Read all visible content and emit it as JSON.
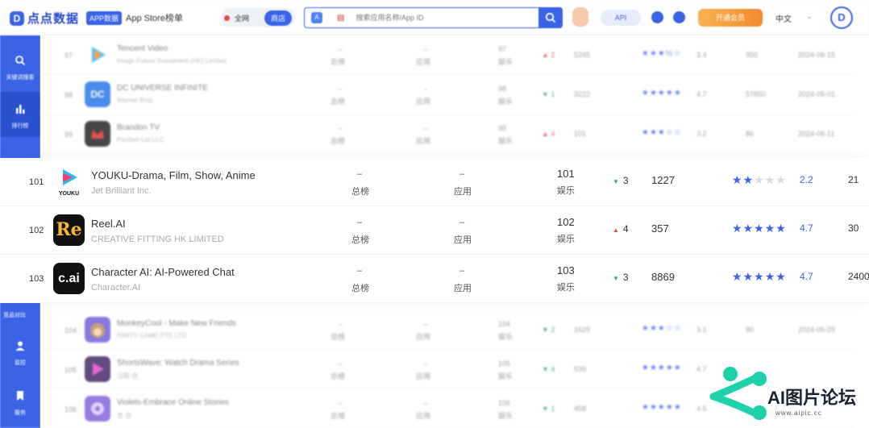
{
  "header": {
    "logo_text": "点点数据",
    "app_badge": "APP数据",
    "store_title": "App Store榜单",
    "scope_all": "全网",
    "scope_active": "商店",
    "search_placeholder": "搜索应用名称/App ID",
    "api_label": "API",
    "vip_label": "开通会员",
    "language": "中文",
    "avatar_letter": "D"
  },
  "sidebar": {
    "items": [
      {
        "label": "关键词搜索",
        "icon": "search-icon"
      },
      {
        "label": "排行榜",
        "icon": "bar-chart-icon"
      },
      {
        "label": "竞品对比",
        "icon": "compare-icon"
      },
      {
        "label": "监控",
        "icon": "user-icon"
      },
      {
        "label": "服务",
        "icon": "bookmark-icon"
      }
    ]
  },
  "blurred_rows_top": [
    {
      "rank": "97",
      "name": "Tencent Video",
      "publisher": "Image Future Investment (HK) Limited",
      "col_a": "–",
      "col_a_lbl": "总榜",
      "col_b": "–",
      "col_b_lbl": "应用",
      "col_c": "97",
      "col_c_lbl": "娱乐",
      "change": "▲ 2",
      "downloads": "5245",
      "stars": "★★★½☆",
      "score": "3.4",
      "reviews": "950",
      "date": "2024-06-15",
      "icon": "tencent-video-icon"
    },
    {
      "rank": "98",
      "name": "DC UNIVERSE INFINITE",
      "publisher": "Warner Bros",
      "col_a": "–",
      "col_a_lbl": "总榜",
      "col_b": "–",
      "col_b_lbl": "应用",
      "col_c": "98",
      "col_c_lbl": "娱乐",
      "change": "▼ 1",
      "downloads": "3222",
      "stars": "★★★★★",
      "score": "4.7",
      "reviews": "57850",
      "date": "2024-05-01",
      "icon": "dc-universe-icon"
    },
    {
      "rank": "99",
      "name": "Brandon TV",
      "publisher": "Panther Ltd LLC",
      "col_a": "–",
      "col_a_lbl": "总榜",
      "col_b": "–",
      "col_b_lbl": "应用",
      "col_c": "99",
      "col_c_lbl": "娱乐",
      "change": "▲ 4",
      "downloads": "101",
      "stars": "★★★☆☆",
      "score": "3.2",
      "reviews": "86",
      "date": "2024-06-11",
      "icon": "brandon-tv-icon"
    }
  ],
  "focused_rows": [
    {
      "rank": "101",
      "name": "YOUKU-Drama, Film, Show, Anime",
      "publisher": "Jet Brilliant Inc.",
      "col_a": "–",
      "col_a_lbl": "总榜",
      "col_b": "–",
      "col_b_lbl": "应用",
      "col_c": "101",
      "col_c_lbl": "娱乐",
      "change_dir": "down",
      "change": "3",
      "downloads": "1227",
      "stars_on": 2,
      "stars_total": 5,
      "score": "2.2",
      "reviews": "21",
      "icon_text": "YOUKU",
      "icon": "youku-icon"
    },
    {
      "rank": "102",
      "name": "Reel.AI",
      "publisher": "CREATIVE FITTING HK LIMITED",
      "col_a": "–",
      "col_a_lbl": "总榜",
      "col_b": "–",
      "col_b_lbl": "应用",
      "col_c": "102",
      "col_c_lbl": "娱乐",
      "change_dir": "up",
      "change": "4",
      "downloads": "357",
      "stars_on": 5,
      "stars_total": 5,
      "score": "4.7",
      "reviews": "30",
      "icon_text": "Re",
      "icon": "reel-ai-icon"
    },
    {
      "rank": "103",
      "name": "Character AI: AI-Powered Chat",
      "publisher": "Character.AI",
      "col_a": "–",
      "col_a_lbl": "总榜",
      "col_b": "–",
      "col_b_lbl": "应用",
      "col_c": "103",
      "col_c_lbl": "娱乐",
      "change_dir": "down",
      "change": "3",
      "downloads": "8869",
      "stars_on": 5,
      "stars_total": 5,
      "score": "4.7",
      "reviews": "2400",
      "icon_text": "c.ai",
      "icon": "character-ai-icon"
    }
  ],
  "blurred_rows_bottom": [
    {
      "rank": "104",
      "name": "MonkeyCool - Make New Friends",
      "publisher": "PARTY GAME PTE LTD",
      "col_a": "–",
      "col_a_lbl": "总榜",
      "col_b": "–",
      "col_b_lbl": "应用",
      "col_c": "104",
      "col_c_lbl": "娱乐",
      "change": "▼ 2",
      "downloads": "1629",
      "stars": "★★★☆☆",
      "score": "3.1",
      "reviews": "80",
      "date": "2024-05-29",
      "icon": "monkeycool-icon"
    },
    {
      "rank": "105",
      "name": "ShortsWave: Watch Drama Series",
      "publisher": "汉剧 合",
      "col_a": "–",
      "col_a_lbl": "总榜",
      "col_b": "–",
      "col_b_lbl": "应用",
      "col_c": "105",
      "col_c_lbl": "娱乐",
      "change": "▼ 4",
      "downloads": "539",
      "stars": "★★★★★",
      "score": "4.7",
      "reviews": "",
      "date": "",
      "icon": "shortswave-icon"
    },
    {
      "rank": "106",
      "name": "Violets-Embrace Online Stories",
      "publisher": "合 合",
      "col_a": "–",
      "col_a_lbl": "总榜",
      "col_b": "–",
      "col_b_lbl": "应用",
      "col_c": "106",
      "col_c_lbl": "娱乐",
      "change": "▼ 1",
      "downloads": "458",
      "stars": "★★★★★",
      "score": "4.5",
      "reviews": "",
      "date": "",
      "icon": "violets-icon"
    }
  ],
  "watermark": {
    "text": "AI图片论坛",
    "url": "www.aipic.cc"
  },
  "colors": {
    "accent": "#3a63e6",
    "up": "#e5484d",
    "down": "#25a86b",
    "vip": "#f39a3a"
  }
}
